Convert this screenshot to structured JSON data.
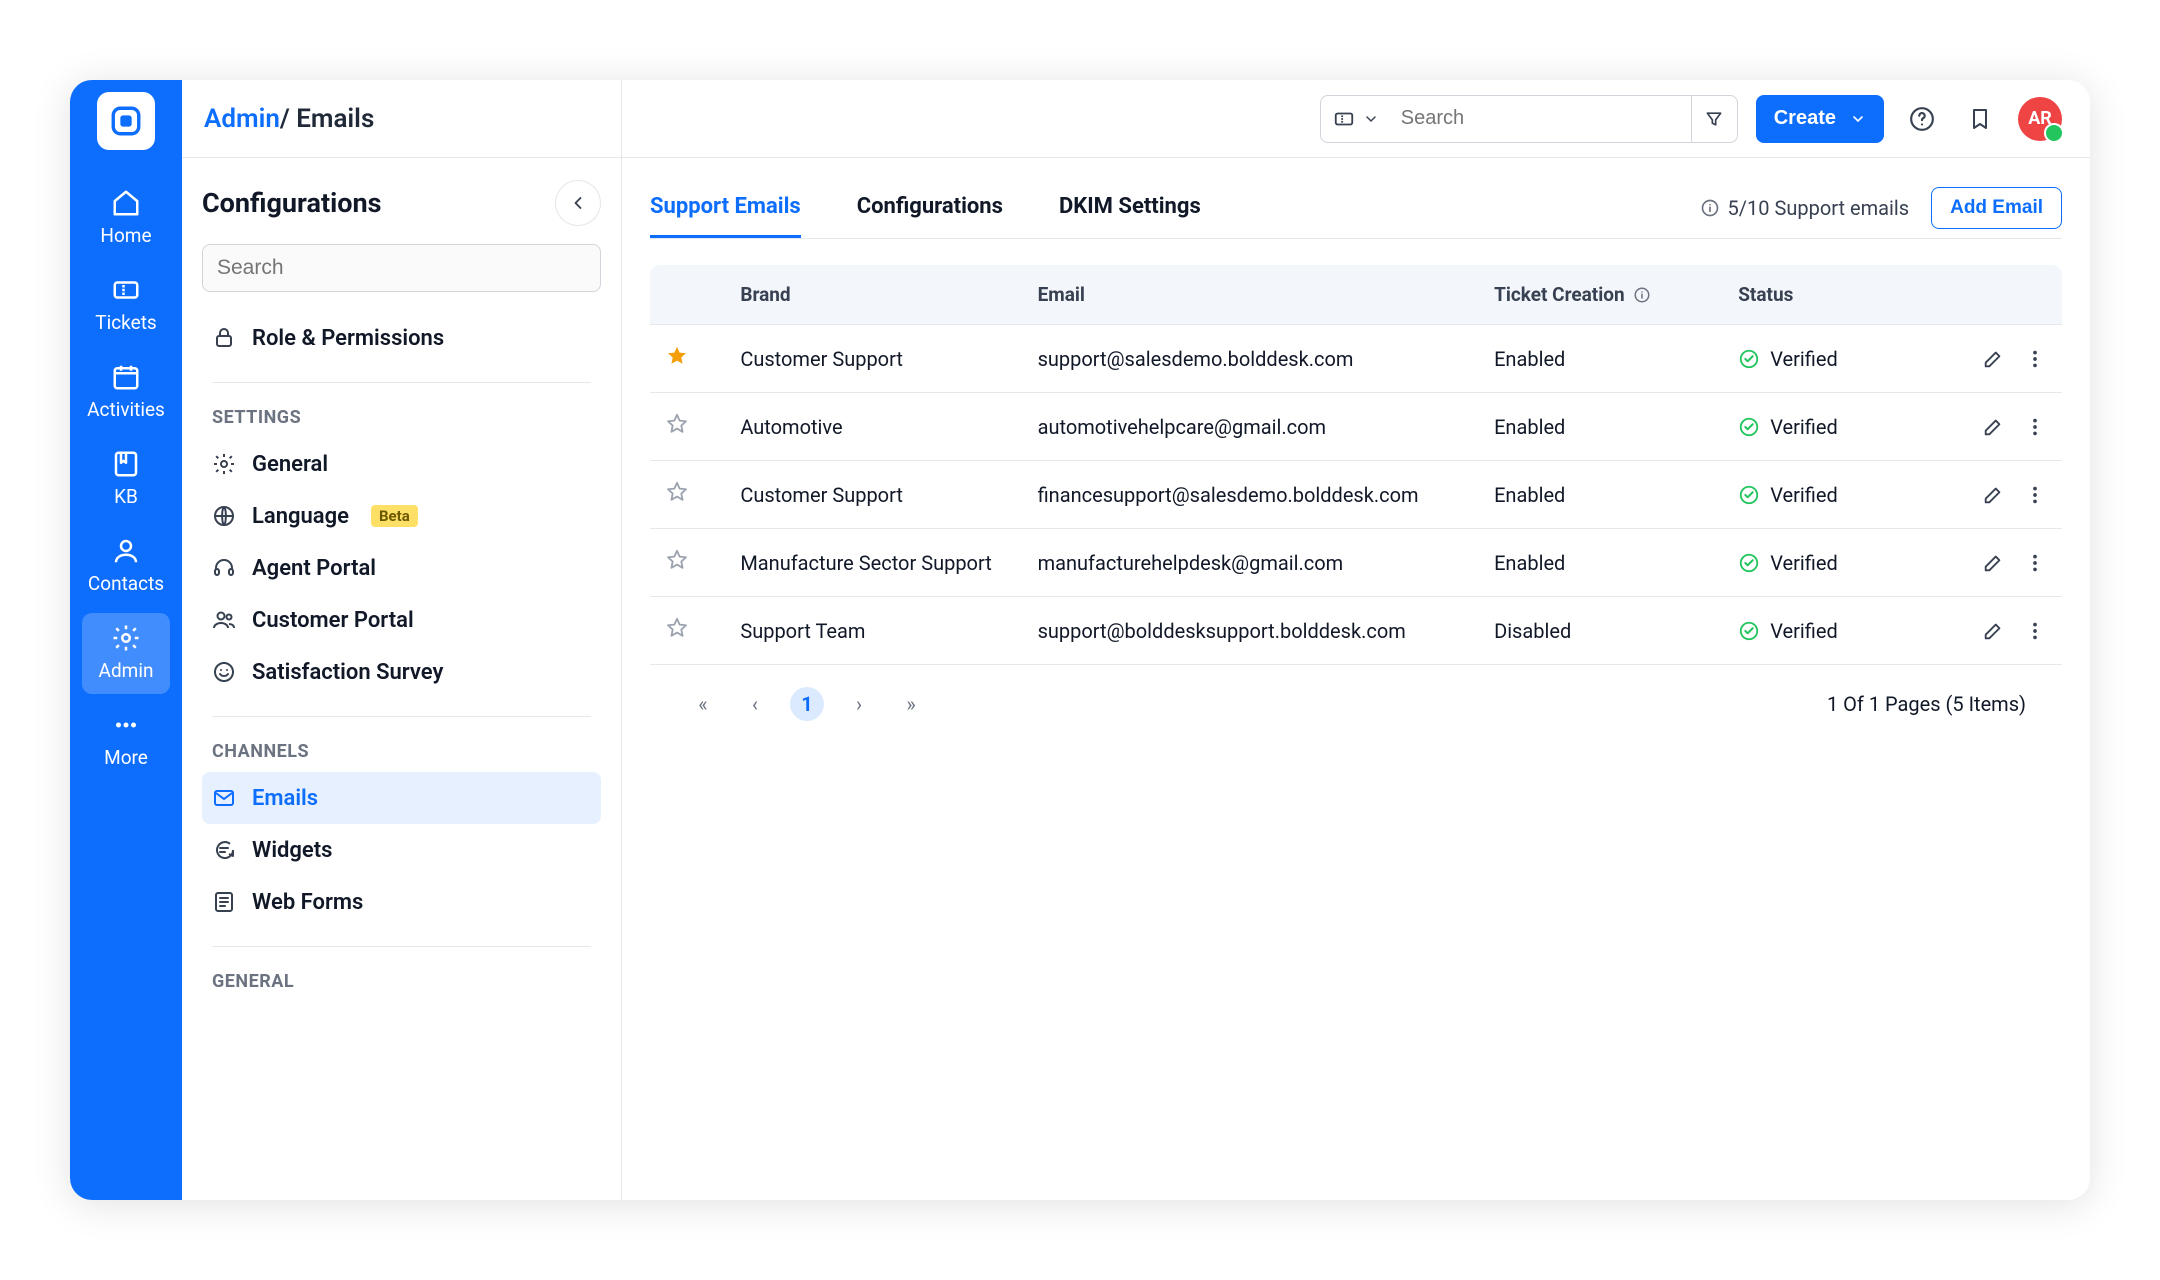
{
  "breadcrumb": {
    "parent": "Admin",
    "separator": "/",
    "current": "Emails"
  },
  "header": {
    "search_placeholder": "Search",
    "create_label": "Create",
    "avatar_initials": "AR"
  },
  "nav": {
    "items": [
      {
        "label": "Home"
      },
      {
        "label": "Tickets"
      },
      {
        "label": "Activities"
      },
      {
        "label": "KB"
      },
      {
        "label": "Contacts"
      },
      {
        "label": "Admin"
      },
      {
        "label": "More"
      }
    ]
  },
  "sidebar": {
    "title": "Configurations",
    "search_placeholder": "Search",
    "top_item": "Role & Permissions",
    "section_settings": "SETTINGS",
    "settings_items": [
      {
        "label": "General"
      },
      {
        "label": "Language",
        "badge": "Beta"
      },
      {
        "label": "Agent Portal"
      },
      {
        "label": "Customer Portal"
      },
      {
        "label": "Satisfaction Survey"
      }
    ],
    "section_channels": "CHANNELS",
    "channels_items": [
      {
        "label": "Emails"
      },
      {
        "label": "Widgets"
      },
      {
        "label": "Web Forms"
      }
    ],
    "section_general": "GENERAL"
  },
  "tabs": {
    "items": [
      {
        "label": "Support Emails"
      },
      {
        "label": "Configurations"
      },
      {
        "label": "DKIM Settings"
      }
    ],
    "support_count": "5/10 Support emails",
    "add_email": "Add Email"
  },
  "table": {
    "columns": {
      "brand": "Brand",
      "email": "Email",
      "ticket_creation": "Ticket Creation",
      "status": "Status"
    },
    "rows": [
      {
        "starred": true,
        "brand": "Customer Support",
        "email": "support@salesdemo.bolddesk.com",
        "ticket_creation": "Enabled",
        "status": "Verified"
      },
      {
        "starred": false,
        "brand": "Automotive",
        "email": "automotivehelpcare@gmail.com",
        "ticket_creation": "Enabled",
        "status": "Verified"
      },
      {
        "starred": false,
        "brand": "Customer Support",
        "email": "financesupport@salesdemo.bolddesk.com",
        "ticket_creation": "Enabled",
        "status": "Verified"
      },
      {
        "starred": false,
        "brand": "Manufacture Sector Support",
        "email": "manufacturehelpdesk@gmail.com",
        "ticket_creation": "Enabled",
        "status": "Verified"
      },
      {
        "starred": false,
        "brand": "Support Team",
        "email": "support@bolddesksupport.bolddesk.com",
        "ticket_creation": "Disabled",
        "status": "Verified"
      }
    ]
  },
  "pagination": {
    "current": "1",
    "summary": "1 Of 1 Pages (5 Items)"
  }
}
